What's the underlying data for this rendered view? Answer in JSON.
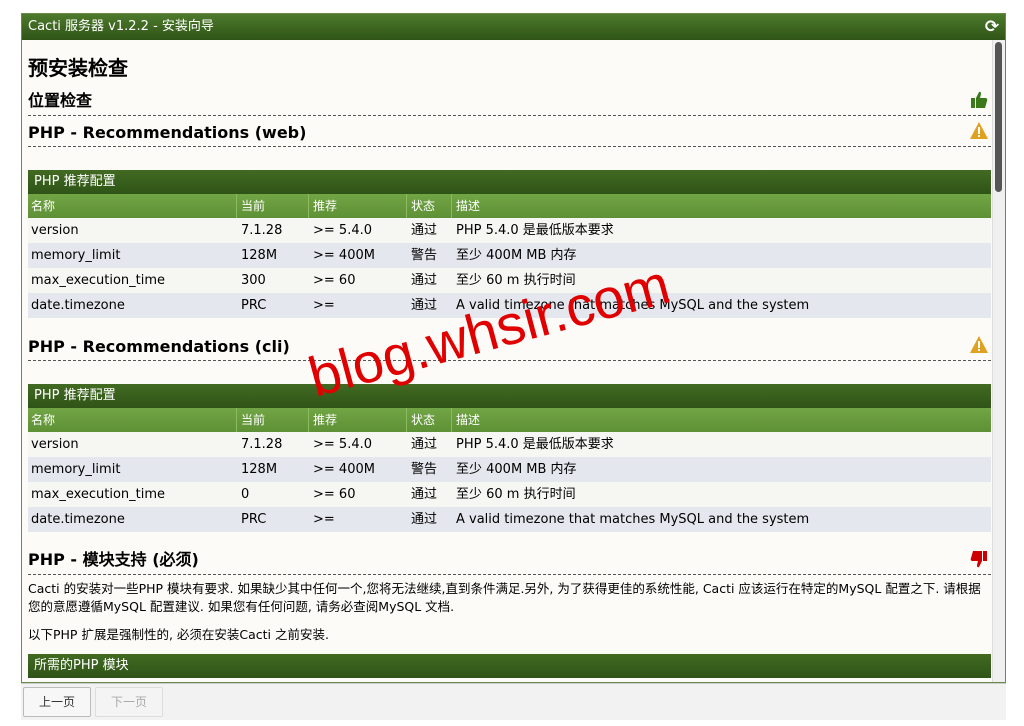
{
  "window": {
    "title": "Cacti 服务器 v1.2.2 - 安装向导"
  },
  "page_title": "预安装检查",
  "location_check": {
    "title": "位置检查"
  },
  "php_web": {
    "title": "PHP - Recommendations (web)",
    "table_title": "PHP 推荐配置",
    "columns": [
      "名称",
      "当前",
      "推荐",
      "状态",
      "描述"
    ],
    "rows": [
      [
        "version",
        "7.1.28",
        ">= 5.4.0",
        "通过",
        "PHP 5.4.0 是最低版本要求"
      ],
      [
        "memory_limit",
        "128M",
        ">= 400M",
        "警告",
        "至少 400M MB 内存"
      ],
      [
        "max_execution_time",
        "300",
        ">= 60",
        "通过",
        "至少 60 m 执行时间"
      ],
      [
        "date.timezone",
        "PRC",
        ">=",
        "通过",
        "A valid timezone that matches MySQL and the system"
      ]
    ]
  },
  "php_cli": {
    "title": "PHP - Recommendations (cli)",
    "table_title": "PHP 推荐配置",
    "columns": [
      "名称",
      "当前",
      "推荐",
      "状态",
      "描述"
    ],
    "rows": [
      [
        "version",
        "7.1.28",
        ">= 5.4.0",
        "通过",
        "PHP 5.4.0 是最低版本要求"
      ],
      [
        "memory_limit",
        "128M",
        ">= 400M",
        "警告",
        "至少 400M MB 内存"
      ],
      [
        "max_execution_time",
        "0",
        ">= 60",
        "通过",
        "至少 60 m 执行时间"
      ],
      [
        "date.timezone",
        "PRC",
        ">=",
        "通过",
        "A valid timezone that matches MySQL and the system"
      ]
    ]
  },
  "modules": {
    "title": "PHP - 模块支持 (必须)",
    "paragraph1": "Cacti 的安装对一些PHP 模块有要求. 如果缺少其中任何一个,您将无法继续,直到条件满足.另外, 为了获得更佳的系统性能, Cacti 应该运行在特定的MySQL 配置之下. 请根据您的意愿遵循MySQL 配置建议. 如果您有任何问题, 请务必查阅MySQL 文档.",
    "paragraph2": "以下PHP 扩展是强制性的, 必须在安装Cacti 之前安装.",
    "table_title": "所需的PHP 模块"
  },
  "footer": {
    "prev_label": "上一页",
    "next_label": "下一页"
  },
  "watermark": "blog.whsir.com",
  "colors": {
    "header_dark": "#2f5417",
    "header_light": "#5e9035",
    "ok_icon": "#3a7a1a",
    "warn_icon": "#e0a020",
    "fail_icon": "#cc0000"
  }
}
